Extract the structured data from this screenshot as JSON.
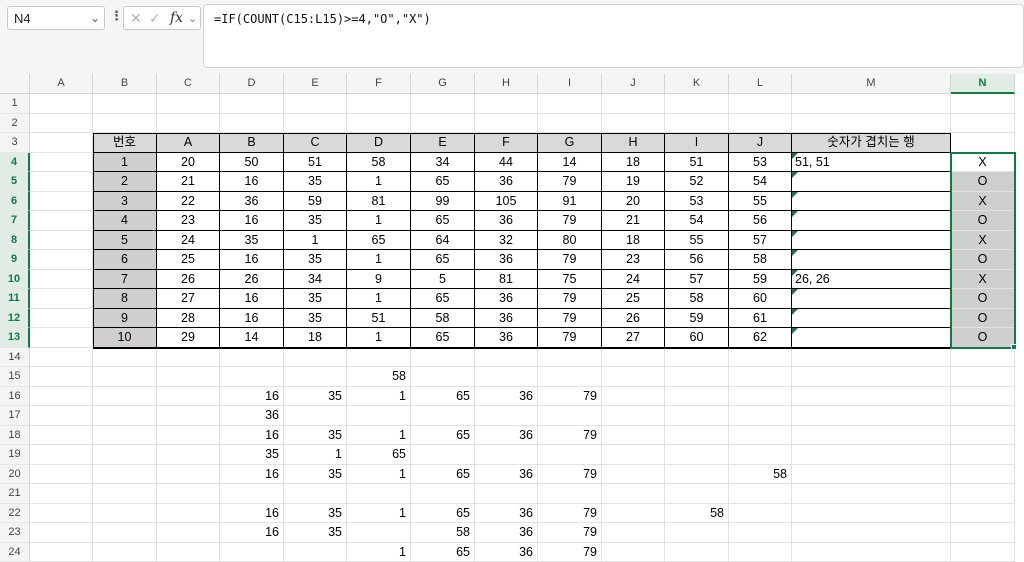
{
  "formula_bar": {
    "name_box": "N4",
    "formula": "=IF(COUNT(C15:L15)>=4,\"O\",\"X\")",
    "icons": [
      "chevron-down-icon",
      "more-icon",
      "cancel-icon",
      "confirm-icon",
      "function-icon"
    ],
    "fx_label": "fx"
  },
  "columns": [
    "A",
    "B",
    "C",
    "D",
    "E",
    "F",
    "G",
    "H",
    "I",
    "J",
    "K",
    "L",
    "M",
    "N"
  ],
  "selected_column": "N",
  "rows": [
    "1",
    "2",
    "3",
    "4",
    "5",
    "6",
    "7",
    "8",
    "9",
    "10",
    "11",
    "12",
    "13",
    "14",
    "15",
    "16",
    "17",
    "18",
    "19",
    "20",
    "21",
    "22",
    "23",
    "24"
  ],
  "selected_rows": [
    "4",
    "5",
    "6",
    "7",
    "8",
    "9",
    "10",
    "11",
    "12",
    "13"
  ],
  "table": {
    "headers": [
      "번호",
      "A",
      "B",
      "C",
      "D",
      "E",
      "F",
      "G",
      "H",
      "I",
      "J",
      "숫자가 겹치는 행"
    ],
    "rows": [
      [
        "1",
        "20",
        "50",
        "51",
        "58",
        "34",
        "44",
        "14",
        "18",
        "51",
        "53",
        "51, 51"
      ],
      [
        "2",
        "21",
        "16",
        "35",
        "1",
        "65",
        "36",
        "79",
        "19",
        "52",
        "54",
        ""
      ],
      [
        "3",
        "22",
        "36",
        "59",
        "81",
        "99",
        "105",
        "91",
        "20",
        "53",
        "55",
        ""
      ],
      [
        "4",
        "23",
        "16",
        "35",
        "1",
        "65",
        "36",
        "79",
        "21",
        "54",
        "56",
        ""
      ],
      [
        "5",
        "24",
        "35",
        "1",
        "65",
        "64",
        "32",
        "80",
        "18",
        "55",
        "57",
        ""
      ],
      [
        "6",
        "25",
        "16",
        "35",
        "1",
        "65",
        "36",
        "79",
        "23",
        "56",
        "58",
        ""
      ],
      [
        "7",
        "26",
        "26",
        "34",
        "9",
        "5",
        "81",
        "75",
        "24",
        "57",
        "59",
        "26, 26"
      ],
      [
        "8",
        "27",
        "16",
        "35",
        "1",
        "65",
        "36",
        "79",
        "25",
        "58",
        "60",
        ""
      ],
      [
        "9",
        "28",
        "16",
        "35",
        "51",
        "58",
        "36",
        "79",
        "26",
        "59",
        "61",
        ""
      ],
      [
        "10",
        "29",
        "14",
        "18",
        "1",
        "65",
        "36",
        "79",
        "27",
        "60",
        "62",
        ""
      ]
    ],
    "result_column": [
      "X",
      "O",
      "X",
      "O",
      "X",
      "O",
      "X",
      "O",
      "O",
      "O"
    ]
  },
  "lower_cells": {
    "15": {
      "F": "58"
    },
    "16": {
      "D": "16",
      "E": "35",
      "F": "1",
      "G": "65",
      "H": "36",
      "I": "79"
    },
    "17": {
      "D": "36"
    },
    "18": {
      "D": "16",
      "E": "35",
      "F": "1",
      "G": "65",
      "H": "36",
      "I": "79"
    },
    "19": {
      "D": "35",
      "E": "1",
      "F": "65"
    },
    "20": {
      "D": "16",
      "E": "35",
      "F": "1",
      "G": "65",
      "H": "36",
      "I": "79",
      "L": "58"
    },
    "22": {
      "D": "16",
      "E": "35",
      "F": "1",
      "G": "65",
      "H": "36",
      "I": "79",
      "K": "58"
    },
    "23": {
      "D": "16",
      "E": "35",
      "G": "58",
      "H": "36",
      "I": "79"
    },
    "24": {
      "F": "1",
      "G": "65",
      "H": "36",
      "I": "79"
    }
  },
  "colors": {
    "accent": "#107c41",
    "header_fill": "#d9d9d9",
    "number_fill": "#d0cece",
    "error_triangle": "#1e7145"
  }
}
